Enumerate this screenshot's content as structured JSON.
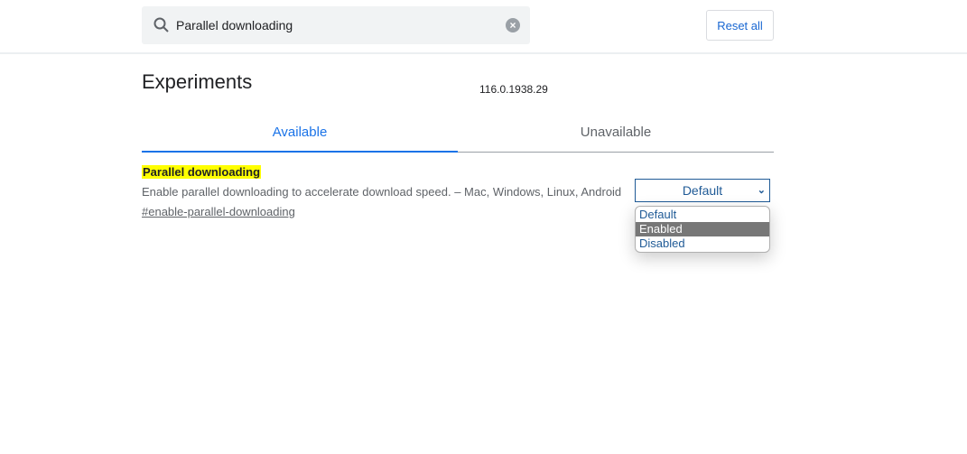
{
  "search": {
    "value": "Parallel downloading",
    "clear_label": "×"
  },
  "header": {
    "reset_label": "Reset all"
  },
  "page": {
    "title": "Experiments",
    "version": "116.0.1938.29"
  },
  "tabs": [
    {
      "label": "Available"
    },
    {
      "label": "Unavailable"
    }
  ],
  "experiment": {
    "name": "Parallel downloading",
    "description": "Enable parallel downloading to accelerate download speed. – Mac, Windows, Linux, Android",
    "link": "#enable-parallel-downloading",
    "selected": "Default",
    "options": [
      "Default",
      "Enabled",
      "Disabled"
    ],
    "highlighted_option": "Enabled"
  },
  "colors": {
    "accent": "#1a73e8",
    "highlight": "#ffff00"
  }
}
